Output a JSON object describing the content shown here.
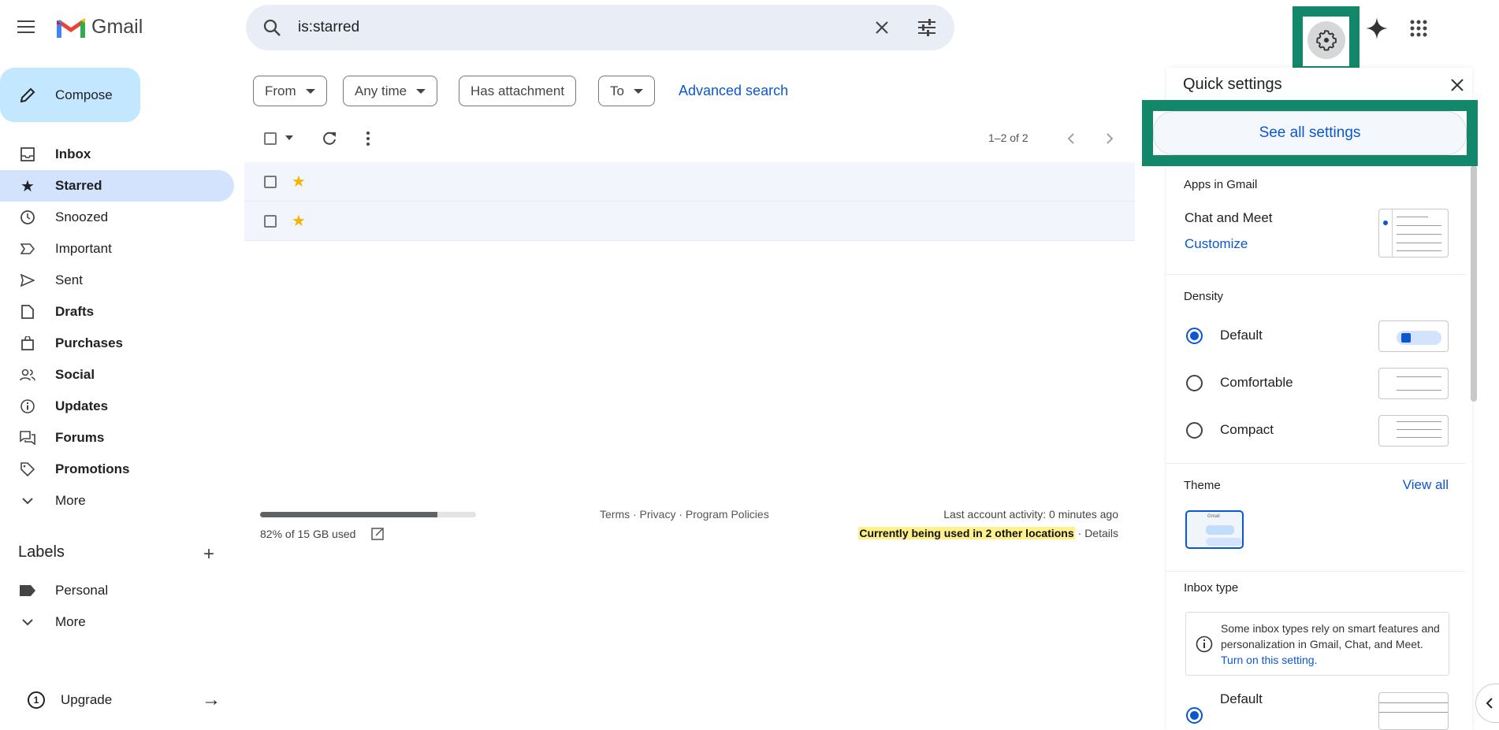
{
  "header": {
    "app_name": "Gmail",
    "search_value": "is:starred",
    "icons": [
      "menu-icon",
      "search-icon",
      "close-icon",
      "tune-icon",
      "gear-icon",
      "gemini-sparkle-icon",
      "apps-grid-icon"
    ]
  },
  "sidebar": {
    "compose_label": "Compose",
    "items": [
      {
        "label": "Inbox",
        "icon": "inbox-icon"
      },
      {
        "label": "Starred",
        "icon": "star-icon",
        "active": true
      },
      {
        "label": "Snoozed",
        "icon": "clock-icon"
      },
      {
        "label": "Important",
        "icon": "label-important-icon"
      },
      {
        "label": "Sent",
        "icon": "send-icon"
      },
      {
        "label": "Drafts",
        "icon": "draft-icon"
      },
      {
        "label": "Purchases",
        "icon": "shopping-bag-icon"
      },
      {
        "label": "Social",
        "icon": "people-icon"
      },
      {
        "label": "Updates",
        "icon": "info-icon"
      },
      {
        "label": "Forums",
        "icon": "forum-icon"
      },
      {
        "label": "Promotions",
        "icon": "tag-icon"
      },
      {
        "label": "More",
        "icon": "chevron-down-icon"
      }
    ],
    "labels_heading": "Labels",
    "labels": [
      {
        "label": "Personal"
      },
      {
        "label": "More"
      }
    ],
    "upgrade_label": "Upgrade"
  },
  "filters": {
    "chips": [
      "From",
      "Any time",
      "Has attachment",
      "To"
    ],
    "advanced_search": "Advanced search"
  },
  "toolbar": {
    "pagination": "1–2 of 2"
  },
  "footer": {
    "storage_text": "82% of 15 GB used",
    "storage_fraction": 0.82,
    "links": "Terms · Privacy · Program Policies",
    "last_activity": "Last account activity: 0 minutes ago",
    "other_locations": "Currently being used in 2 other locations",
    "details": "· Details"
  },
  "quick_settings": {
    "title": "Quick settings",
    "see_all": "See all settings",
    "apps_heading": "Apps in Gmail",
    "chat_meet": "Chat and Meet",
    "customize": "Customize",
    "density_heading": "Density",
    "density_options": [
      {
        "label": "Default",
        "selected": true
      },
      {
        "label": "Comfortable"
      },
      {
        "label": "Compact"
      }
    ],
    "theme_heading": "Theme",
    "view_all": "View all",
    "theme_thumb_text": "Gmail",
    "inbox_type_heading": "Inbox type",
    "inbox_info": "Some inbox types rely on smart features and personalization in Gmail, Chat, and Meet.",
    "inbox_info_link": "Turn on this setting.",
    "inbox_default": "Default"
  },
  "colors": {
    "highlight_box": "#12876a",
    "accent": "#0b57d0",
    "active_nav": "#d3e3fd",
    "compose": "#c2e7ff",
    "location_highlight": "#fef08a"
  }
}
